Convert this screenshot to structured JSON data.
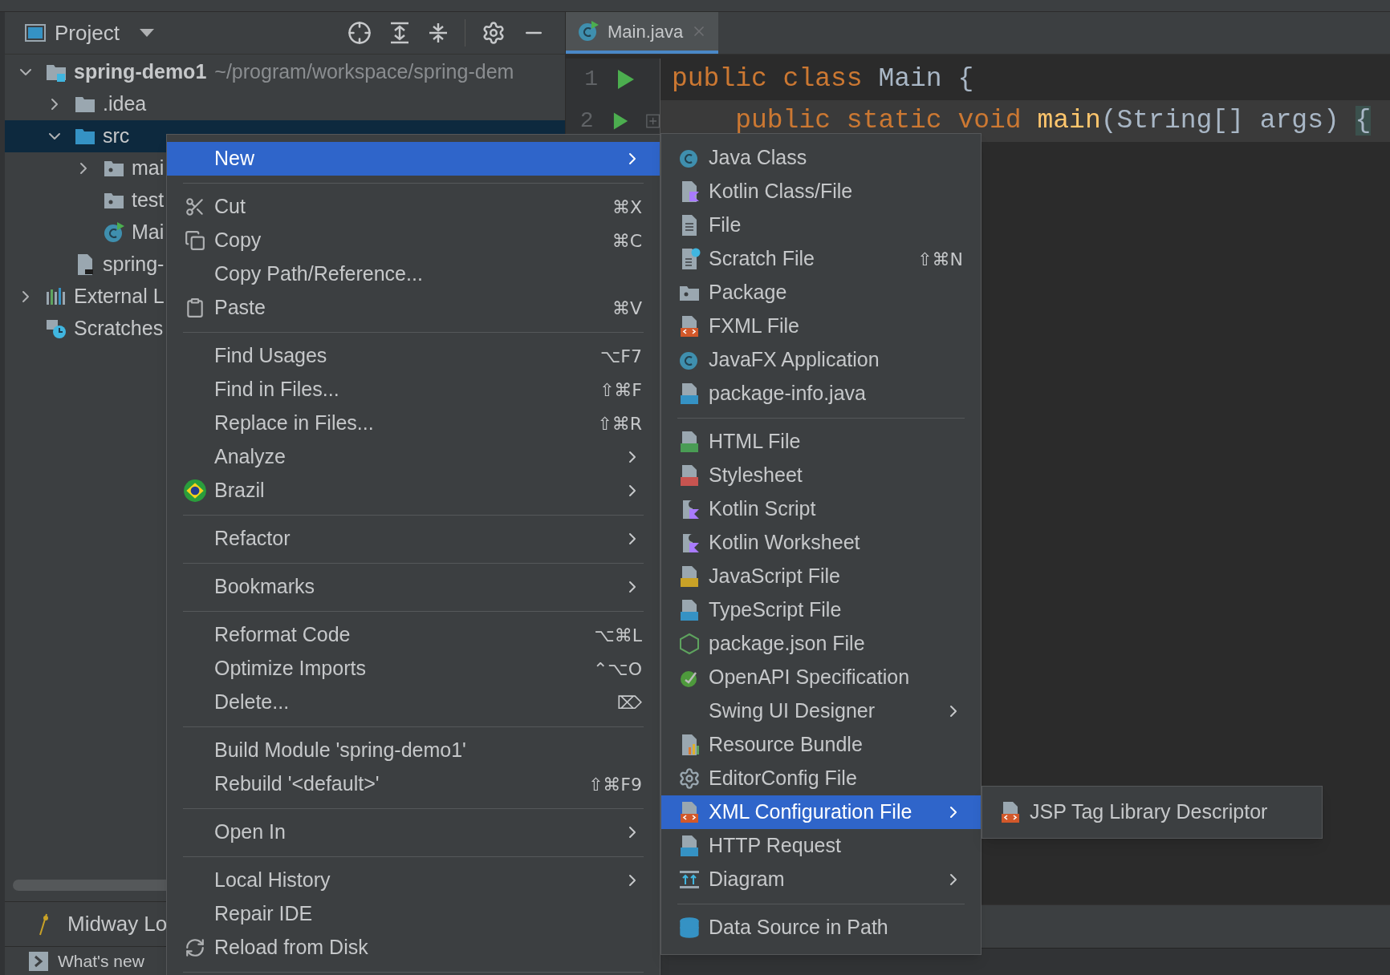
{
  "project_panel": {
    "title": "Project",
    "tree": [
      {
        "label": "spring-demo1",
        "path": "~/program/workspace/spring-dem",
        "expanded": true,
        "selected": false,
        "children": [
          {
            "label": ".idea",
            "expanded": false,
            "selected": false
          },
          {
            "label": "src",
            "expanded": true,
            "selected": true,
            "children": [
              {
                "label": "mai",
                "expanded": false,
                "selected": false
              },
              {
                "label": "test",
                "selected": false
              },
              {
                "label": "Mai",
                "selected": false
              }
            ]
          },
          {
            "label": "spring-",
            "selected": false
          }
        ]
      },
      {
        "label": "External L",
        "expanded": false,
        "selected": false
      },
      {
        "label": "Scratches",
        "selected": false
      }
    ],
    "bottom_items": [
      "Midway Lo",
      "What's new"
    ]
  },
  "editor": {
    "tab": {
      "label": "Main.java",
      "selected": true
    },
    "lines": [
      {
        "number": "1",
        "current": false,
        "tokens": [
          {
            "kind": "keyword",
            "text": "public class "
          },
          {
            "kind": "plain",
            "text": "Main {"
          }
        ]
      },
      {
        "number": "2",
        "current": true,
        "tokens": [
          {
            "kind": "keyword",
            "text": "    public static void "
          },
          {
            "kind": "method",
            "text": "main"
          },
          {
            "kind": "plain",
            "text": "(String[] args) "
          },
          {
            "kind": "brace",
            "text": "{"
          }
        ]
      }
    ]
  },
  "context_menu": {
    "items": [
      {
        "kind": "item",
        "label": "New",
        "submenu": true,
        "selected": true
      },
      {
        "kind": "separator"
      },
      {
        "kind": "item",
        "label": "Cut",
        "shortcut": "⌘X",
        "selected": false
      },
      {
        "kind": "item",
        "label": "Copy",
        "shortcut": "⌘C",
        "selected": false
      },
      {
        "kind": "item",
        "label": "Copy Path/Reference...",
        "selected": false
      },
      {
        "kind": "item",
        "label": "Paste",
        "shortcut": "⌘V",
        "selected": false
      },
      {
        "kind": "separator"
      },
      {
        "kind": "item",
        "label": "Find Usages",
        "shortcut": "⌥F7",
        "selected": false
      },
      {
        "kind": "item",
        "label": "Find in Files...",
        "shortcut": "⇧⌘F",
        "selected": false
      },
      {
        "kind": "item",
        "label": "Replace in Files...",
        "shortcut": "⇧⌘R",
        "selected": false
      },
      {
        "kind": "item",
        "label": "Analyze",
        "submenu": true,
        "selected": false
      },
      {
        "kind": "item",
        "label": "Brazil",
        "submenu": true,
        "selected": false
      },
      {
        "kind": "separator"
      },
      {
        "kind": "item",
        "label": "Refactor",
        "submenu": true,
        "selected": false
      },
      {
        "kind": "separator"
      },
      {
        "kind": "item",
        "label": "Bookmarks",
        "submenu": true,
        "selected": false
      },
      {
        "kind": "separator"
      },
      {
        "kind": "item",
        "label": "Reformat Code",
        "shortcut": "⌥⌘L",
        "selected": false
      },
      {
        "kind": "item",
        "label": "Optimize Imports",
        "shortcut": "⌃⌥O",
        "selected": false
      },
      {
        "kind": "item",
        "label": "Delete...",
        "shortcut": "⌦",
        "selected": false
      },
      {
        "kind": "separator"
      },
      {
        "kind": "item",
        "label": "Build Module 'spring-demo1'",
        "selected": false
      },
      {
        "kind": "item",
        "label": "Rebuild '<default>'",
        "shortcut": "⇧⌘F9",
        "selected": false
      },
      {
        "kind": "separator"
      },
      {
        "kind": "item",
        "label": "Open In",
        "submenu": true,
        "selected": false
      },
      {
        "kind": "separator"
      },
      {
        "kind": "item",
        "label": "Local History",
        "submenu": true,
        "selected": false
      },
      {
        "kind": "item",
        "label": "Repair IDE",
        "selected": false
      },
      {
        "kind": "item",
        "label": "Reload from Disk",
        "selected": false
      },
      {
        "kind": "separator"
      }
    ]
  },
  "new_submenu": {
    "items": [
      {
        "kind": "item",
        "label": "Java Class",
        "selected": false
      },
      {
        "kind": "item",
        "label": "Kotlin Class/File",
        "selected": false
      },
      {
        "kind": "item",
        "label": "File",
        "selected": false
      },
      {
        "kind": "item",
        "label": "Scratch File",
        "shortcut": "⇧⌘N",
        "selected": false
      },
      {
        "kind": "item",
        "label": "Package",
        "selected": false
      },
      {
        "kind": "item",
        "label": "FXML File",
        "selected": false
      },
      {
        "kind": "item",
        "label": "JavaFX Application",
        "selected": false
      },
      {
        "kind": "item",
        "label": "package-info.java",
        "selected": false
      },
      {
        "kind": "separator"
      },
      {
        "kind": "item",
        "label": "HTML File",
        "selected": false
      },
      {
        "kind": "item",
        "label": "Stylesheet",
        "selected": false
      },
      {
        "kind": "item",
        "label": "Kotlin Script",
        "selected": false
      },
      {
        "kind": "item",
        "label": "Kotlin Worksheet",
        "selected": false
      },
      {
        "kind": "item",
        "label": "JavaScript File",
        "selected": false
      },
      {
        "kind": "item",
        "label": "TypeScript File",
        "selected": false
      },
      {
        "kind": "item",
        "label": "package.json File",
        "selected": false
      },
      {
        "kind": "item",
        "label": "OpenAPI Specification",
        "selected": false
      },
      {
        "kind": "item",
        "label": "Swing UI Designer",
        "submenu": true,
        "selected": false
      },
      {
        "kind": "item",
        "label": "Resource Bundle",
        "selected": false
      },
      {
        "kind": "item",
        "label": "EditorConfig File",
        "selected": false
      },
      {
        "kind": "item",
        "label": "XML Configuration File",
        "submenu": true,
        "selected": true
      },
      {
        "kind": "item",
        "label": "HTTP Request",
        "selected": false
      },
      {
        "kind": "item",
        "label": "Diagram",
        "submenu": true,
        "selected": false
      },
      {
        "kind": "separator"
      },
      {
        "kind": "item",
        "label": "Data Source in Path",
        "selected": false
      }
    ]
  },
  "xml_submenu": {
    "items": [
      {
        "kind": "item",
        "label": "JSP Tag Library Descriptor",
        "selected": false
      }
    ]
  }
}
